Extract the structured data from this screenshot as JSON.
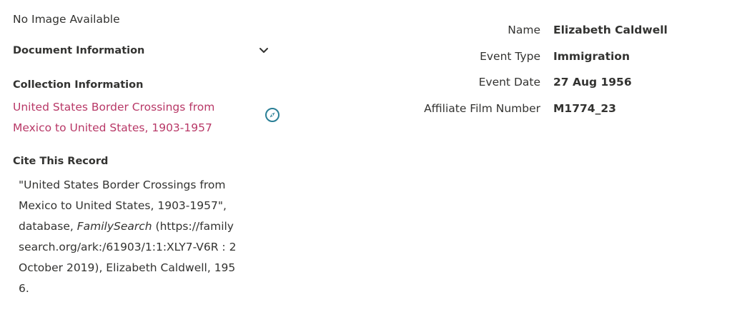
{
  "left": {
    "no_image": "No Image Available",
    "document_information": "Document Information",
    "collection_information": "Collection Information",
    "collection_link_line1": "United States Border Crossings from",
    "collection_link_line2": "Mexico to United States, 1903-1957",
    "cite_heading": "Cite This Record",
    "cite_part1": "\"United States Border Crossings from Mexico to United States, 1903-1957\", database, ",
    "cite_italic": "FamilySearch",
    "cite_part2": " (https://familysearch.org/ark:/61903/1:1:XLY7-V6R : 2 October 2019), Elizabeth Caldwell, 1956."
  },
  "fields": [
    {
      "label": "Name",
      "value": "Elizabeth Caldwell"
    },
    {
      "label": "Event Type",
      "value": "Immigration"
    },
    {
      "label": "Event Date",
      "value": "27 Aug 1956"
    },
    {
      "label": "Affiliate Film Number",
      "value": "M1774_23"
    }
  ],
  "icons": {
    "chevron": "chevron-down-icon",
    "compass": "compass-icon"
  },
  "colors": {
    "link": "#b83867",
    "text": "#333331",
    "compass": "#2a7f96"
  }
}
